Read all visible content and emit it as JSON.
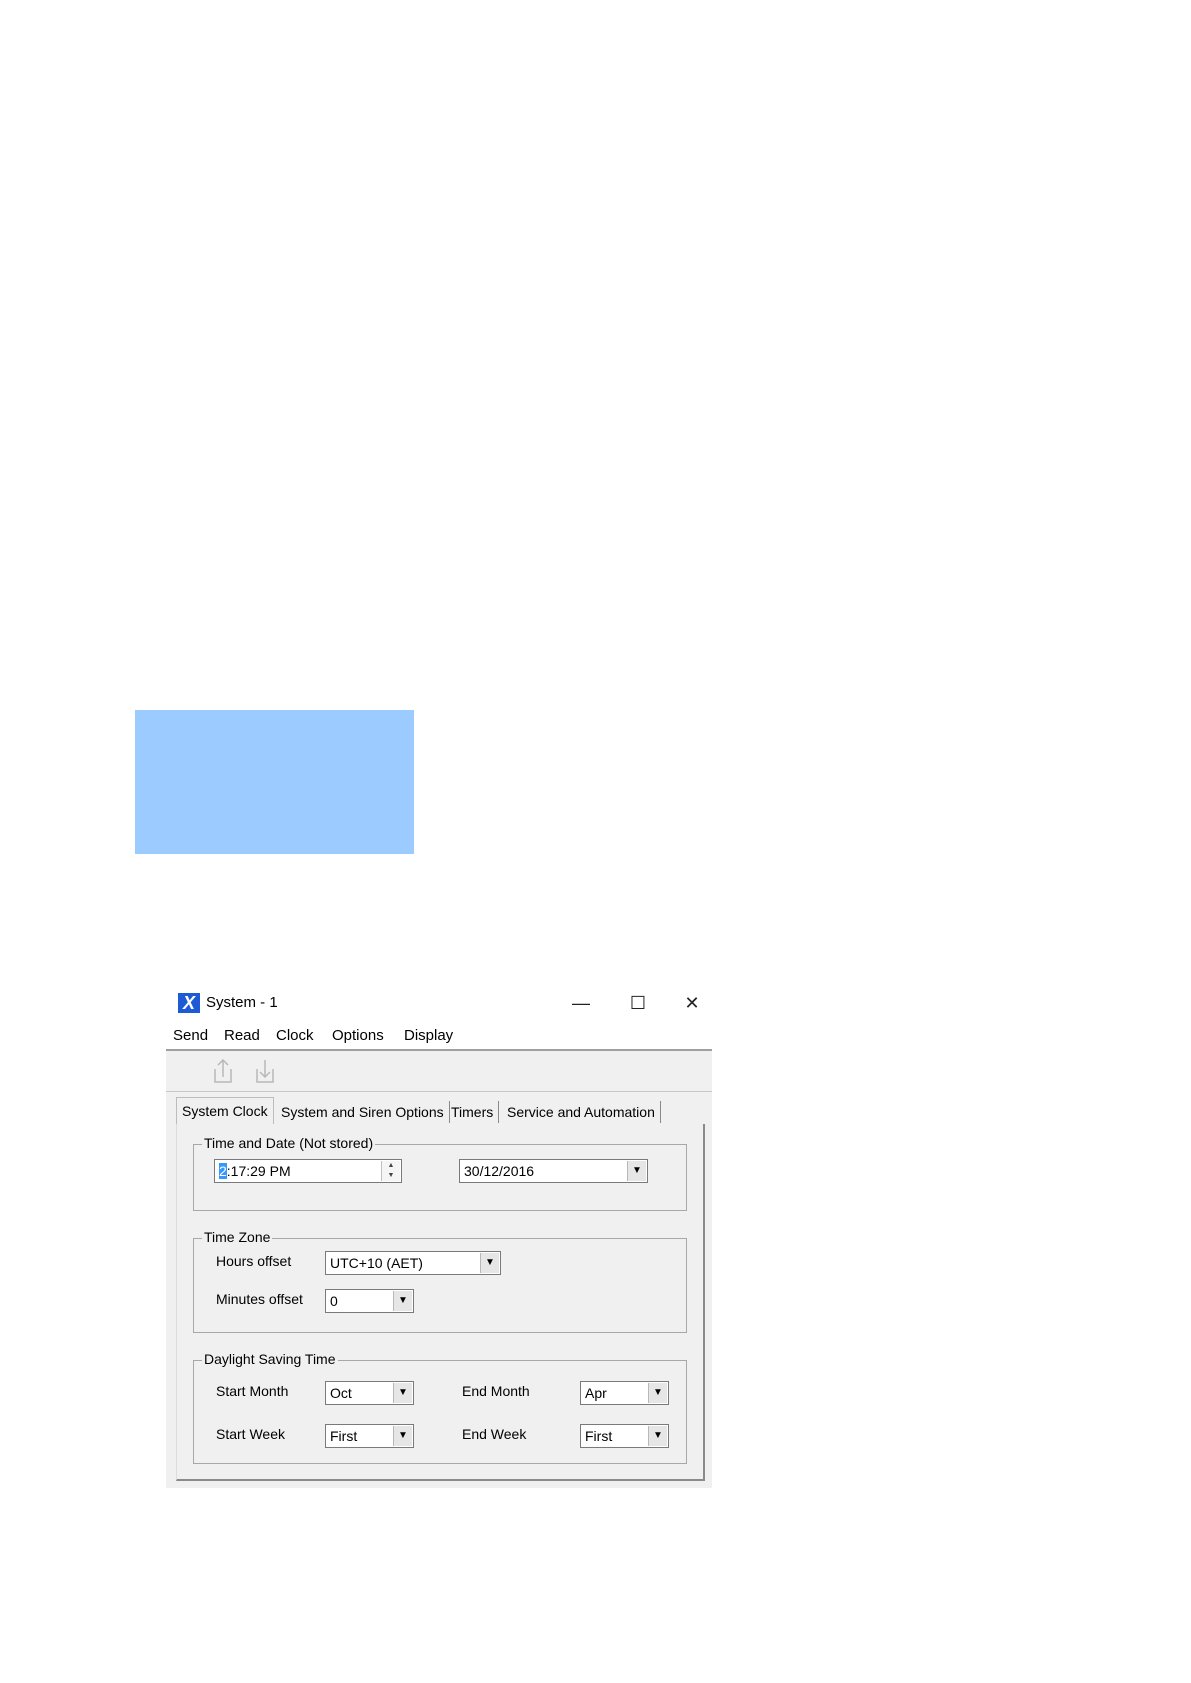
{
  "window": {
    "title": "System - 1",
    "controls": {
      "minimize": "—",
      "maximize": "☐",
      "close": "✕"
    }
  },
  "menu": [
    "Send",
    "Read",
    "Clock",
    "Options",
    "Display"
  ],
  "toolbar": {
    "icons": [
      "upload-icon",
      "download-icon"
    ]
  },
  "tabs": [
    {
      "label": "System Clock",
      "active": true
    },
    {
      "label": "System and Siren Options",
      "active": false
    },
    {
      "label": "Timers",
      "active": false
    },
    {
      "label": "Service and Automation",
      "active": false
    }
  ],
  "time_date": {
    "group_label": "Time and Date (Not stored)",
    "time_selected_char": "2",
    "time_rest": ":17:29 PM",
    "date_value": "30/12/2016"
  },
  "time_zone": {
    "group_label": "Time Zone",
    "hours_label": "Hours offset",
    "hours_value": "UTC+10 (AET)",
    "minutes_label": "Minutes offset",
    "minutes_value": "0"
  },
  "dst": {
    "group_label": "Daylight Saving Time",
    "start_month_label": "Start Month",
    "start_month_value": "Oct",
    "end_month_label": "End Month",
    "end_month_value": "Apr",
    "start_week_label": "Start Week",
    "start_week_value": "First",
    "end_week_label": "End Week",
    "end_week_value": "First"
  },
  "colors": {
    "highlight_block": "#9ccbff",
    "app_icon": "#1d5bd6",
    "selection": "#3399ff"
  }
}
